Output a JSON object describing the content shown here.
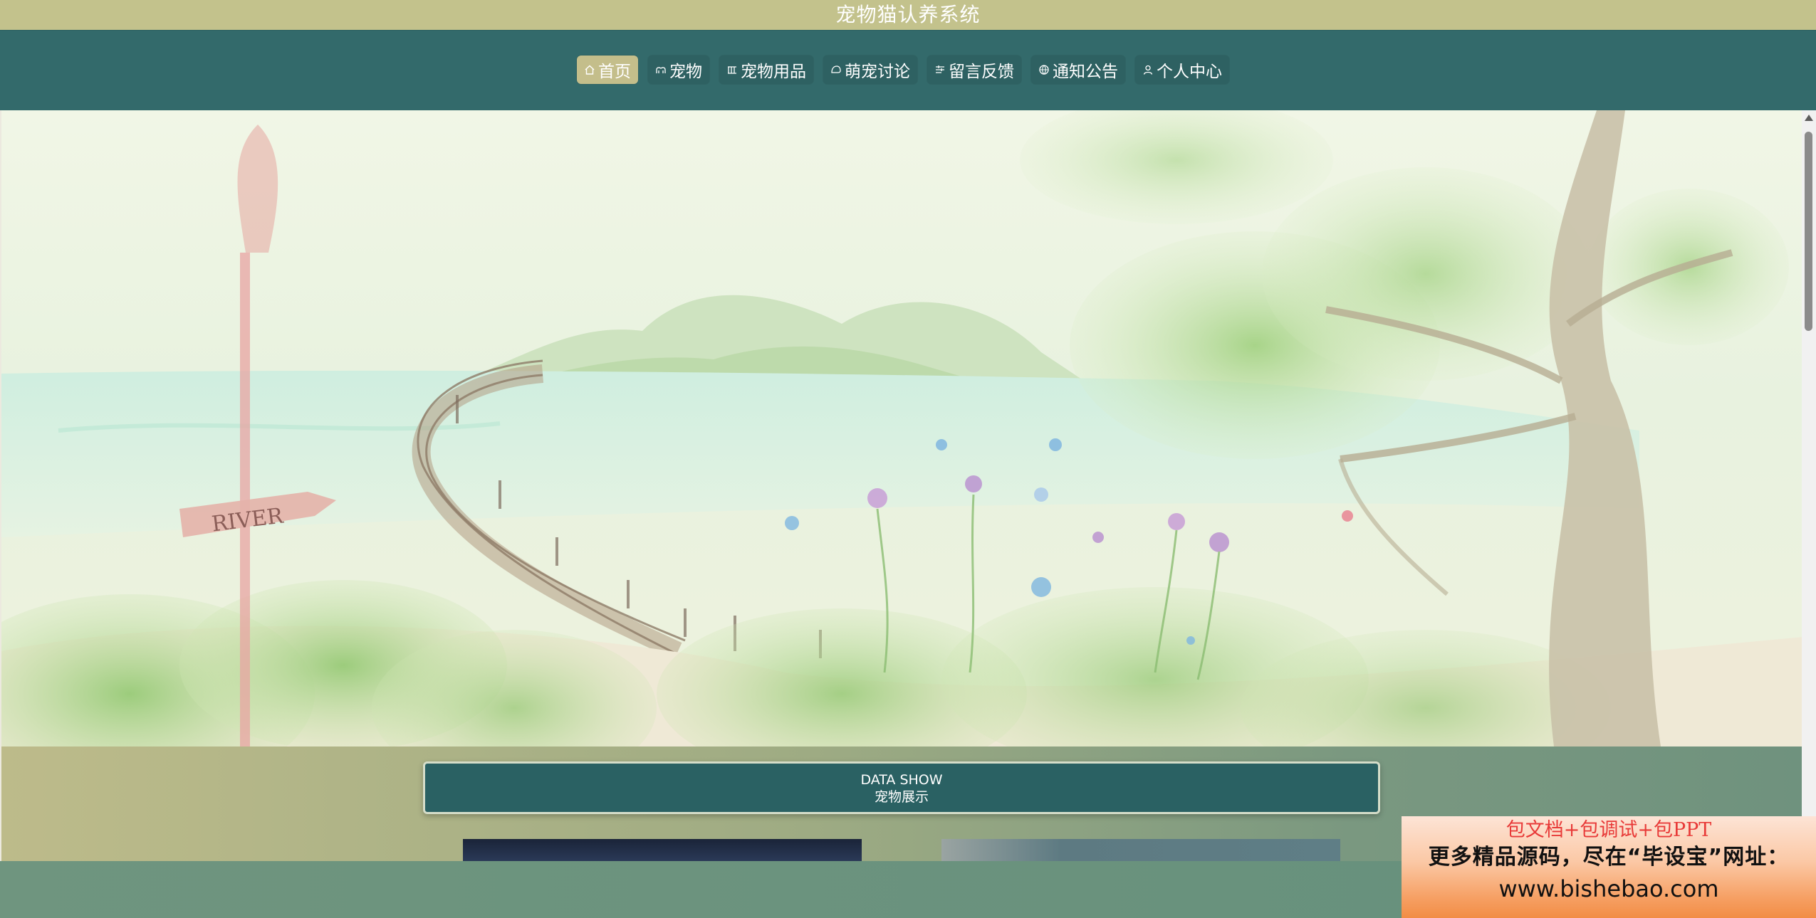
{
  "app": {
    "title": "宠物猫认养系统"
  },
  "nav": {
    "items": [
      {
        "label": "首页",
        "icon": "home-icon",
        "active": true
      },
      {
        "label": "宠物",
        "icon": "pet-icon",
        "active": false
      },
      {
        "label": "宠物用品",
        "icon": "supplies-icon",
        "active": false
      },
      {
        "label": "萌宠讨论",
        "icon": "forum-icon",
        "active": false
      },
      {
        "label": "留言反馈",
        "icon": "feedback-icon",
        "active": false
      },
      {
        "label": "通知公告",
        "icon": "notice-icon",
        "active": false
      },
      {
        "label": "个人中心",
        "icon": "user-icon",
        "active": false
      }
    ]
  },
  "banner": {
    "sign_text": "RIVER",
    "slides": 3,
    "active_slide": 1
  },
  "data_section": {
    "title_en": "DATA SHOW",
    "title_cn": "宠物展示"
  },
  "ad": {
    "line1": "包文档+包调试+包PPT",
    "line2": "更多精品源码，尽在“毕设宝”网址：",
    "line3": "www.bishebao.com"
  },
  "colors": {
    "title_bar": "#c3c28c",
    "nav_bar": "#336a6b",
    "nav_active": "#c4be8b",
    "data_header": "#2a6163"
  }
}
